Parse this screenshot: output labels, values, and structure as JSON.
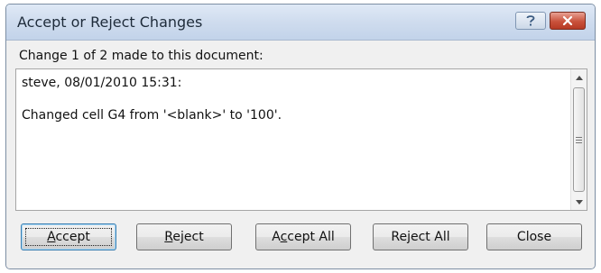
{
  "dialog": {
    "title": "Accept or Reject Changes",
    "help_label": "?",
    "close_label": "×"
  },
  "body": {
    "change_info": "Change 1 of 2 made to this document:",
    "detail_lines": [
      "steve, 08/01/2010 15:31:",
      "Changed cell G4 from '<blank>' to '100'."
    ]
  },
  "buttons": {
    "accept": {
      "label": "Accept",
      "underline": "A",
      "rest": "ccept"
    },
    "reject": {
      "label": "Reject",
      "underline": "R",
      "rest": "eject"
    },
    "accept_all": {
      "label": "Accept All",
      "pre": "A",
      "underline": "c",
      "rest": "cept All"
    },
    "reject_all": {
      "label": "Reject All",
      "pre": "Re",
      "underline": "j",
      "rest": "ect All"
    },
    "close": {
      "label": "Close"
    }
  },
  "icons": {
    "help": "question-mark-icon",
    "close": "close-x-icon",
    "scroll_up": "arrow-up-icon",
    "scroll_down": "arrow-down-icon",
    "thumb_grip": "grip-icon"
  },
  "colors": {
    "close_button": "#c9523c",
    "titlebar": "#cfdcee",
    "default_button_border": "#3c7fb1"
  }
}
